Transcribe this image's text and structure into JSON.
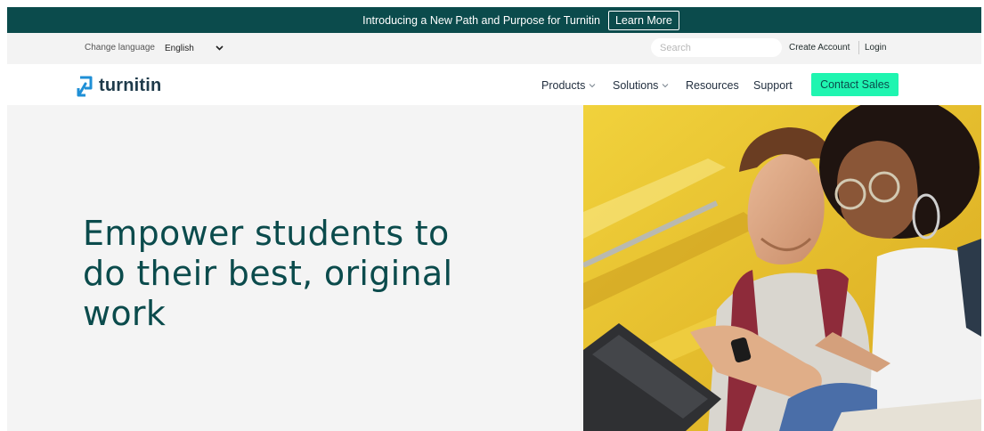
{
  "announcement": {
    "text": "Introducing a New Path and Purpose for Turnitin",
    "cta_label": "Learn More"
  },
  "utility_bar": {
    "language_label": "Change language",
    "language_selected": "English",
    "search_placeholder": "Search",
    "create_account_label": "Create Account",
    "login_label": "Login"
  },
  "nav": {
    "logo_text": "turnitin",
    "items": [
      {
        "label": "Products",
        "has_dropdown": true
      },
      {
        "label": "Solutions",
        "has_dropdown": true
      },
      {
        "label": "Resources",
        "has_dropdown": false
      },
      {
        "label": "Support",
        "has_dropdown": false
      }
    ],
    "contact_label": "Contact Sales"
  },
  "hero": {
    "headline_lines": [
      "Empower students to",
      "do their best, original",
      "work"
    ]
  },
  "colors": {
    "brand_dark_teal": "#0b4b4c",
    "cta_green": "#1ff5b0",
    "logo_blue": "#1f8fd6",
    "hero_background": "#f4f4f4",
    "photo_yellow": "#e9c232"
  },
  "icons": {
    "dropdown": "chevron-down-icon",
    "logo": "turnitin-logo-icon"
  }
}
